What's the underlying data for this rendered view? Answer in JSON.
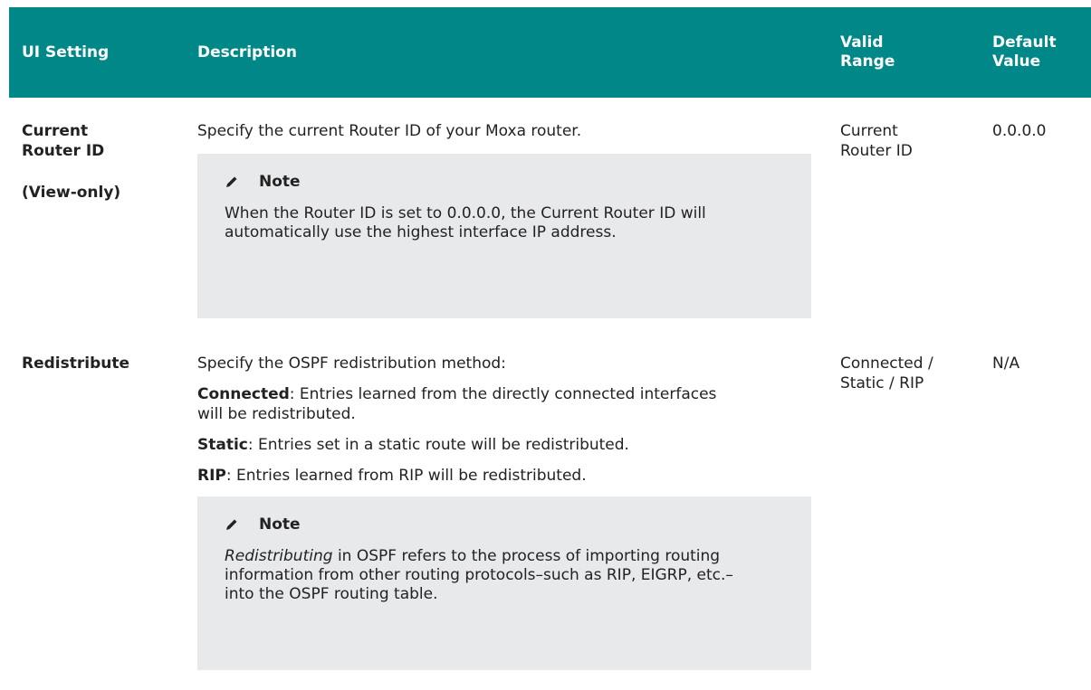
{
  "header": {
    "setting": "UI Setting",
    "description": "Description",
    "valid_range": "Valid Range",
    "default_value": "Default Value"
  },
  "rows": [
    {
      "setting": "Current Router ID",
      "setting_sub": "(View-only)",
      "description": "Specify the current Router ID of your Moxa router.",
      "note": {
        "icon": "pencil-icon",
        "title": "Note",
        "text": "When the Router ID is set to 0.0.0.0, the Current Router ID will automatically use the highest interface IP address."
      },
      "valid_range": "Current Router ID",
      "default_value": "0.0.0.0"
    },
    {
      "setting": "Redistribute",
      "description": "Specify the OSPF redistribution method:",
      "options": [
        {
          "term": "Connected",
          "text": ": Entries learned from the directly connected interfaces will be redistributed."
        },
        {
          "term": "Static",
          "text": ": Entries set in a static route will be redistributed."
        },
        {
          "term": "RIP",
          "text": ": Entries learned from RIP will be redistributed."
        }
      ],
      "note": {
        "icon": "pencil-icon",
        "title": "Note",
        "text_term": "Redistributing",
        "text": " in OSPF refers to the process of importing routing information from other routing protocols–such as RIP, EIGRP, etc.–into the OSPF routing table."
      },
      "valid_range": "Connected / Static / RIP",
      "default_value": "N/A"
    }
  ],
  "colors": {
    "header_bg": "#008787",
    "header_text": "#ffffff",
    "note_bg": "#e8e9eb",
    "body_text": "#222222"
  }
}
